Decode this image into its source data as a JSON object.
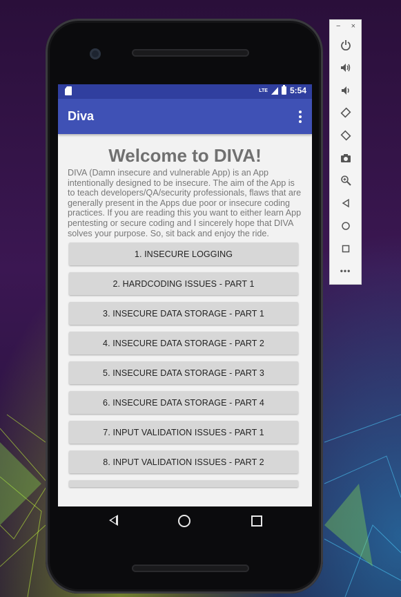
{
  "status_bar": {
    "network": "LTE",
    "time": "5:54"
  },
  "app": {
    "title": "Diva"
  },
  "main": {
    "welcome": "Welcome to DIVA!",
    "description": "DIVA (Damn insecure and vulnerable App) is an App intentionally designed to be insecure. The aim of the App is to teach developers/QA/security professionals, flaws that are generally present in the Apps due poor or insecure coding practices. If you are reading this you want to either learn App pentesting or secure coding and I sincerely hope that DIVA solves your purpose. So, sit back and enjoy the ride.",
    "buttons": [
      "1. INSECURE LOGGING",
      "2. HARDCODING ISSUES - PART 1",
      "3. INSECURE DATA STORAGE - PART 1",
      "4. INSECURE DATA STORAGE - PART 2",
      "5. INSECURE DATA STORAGE - PART 3",
      "6. INSECURE DATA STORAGE - PART 4",
      "7. INPUT VALIDATION ISSUES - PART 1",
      "8. INPUT VALIDATION ISSUES - PART 2"
    ]
  },
  "emulator_toolbar": {
    "minimize": "−",
    "close": "×",
    "icons": [
      "power-icon",
      "volume-up-icon",
      "volume-down-icon",
      "rotate-left-icon",
      "rotate-right-icon",
      "camera-icon",
      "zoom-icon",
      "back-icon",
      "home-icon",
      "overview-icon",
      "more-icon"
    ]
  },
  "colors": {
    "status_bar": "#303f9f",
    "app_bar": "#3f51b5",
    "button": "#d7d7d7"
  }
}
